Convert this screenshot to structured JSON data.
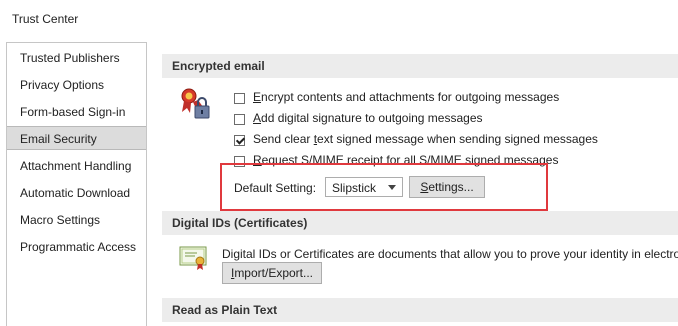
{
  "window": {
    "title": "Trust Center"
  },
  "sidebar": {
    "items": [
      {
        "label": "Trusted Publishers"
      },
      {
        "label": "Privacy Options"
      },
      {
        "label": "Form-based Sign-in"
      },
      {
        "label": "Email Security",
        "selected": true
      },
      {
        "label": "Attachment Handling"
      },
      {
        "label": "Automatic Download"
      },
      {
        "label": "Macro Settings"
      },
      {
        "label": "Programmatic Access"
      }
    ]
  },
  "encrypted": {
    "header": "Encrypted email",
    "icon": "security-certificate-lock-icon",
    "options": [
      {
        "pre": "",
        "u": "E",
        "post": "ncrypt contents and attachments for outgoing messages",
        "checked": false
      },
      {
        "pre": "",
        "u": "A",
        "post": "dd digital signature to outgoing messages",
        "checked": false
      },
      {
        "pre": "Send clear ",
        "u": "t",
        "post": "ext signed message when sending signed messages",
        "checked": true
      },
      {
        "pre": "",
        "u": "R",
        "post": "equest S/MIME receipt for all S/MIME signed messages",
        "checked": false
      }
    ],
    "default_setting_label": "Default Setting:",
    "default_setting_value": "Slipstick",
    "settings_button": {
      "u": "S",
      "post": "ettings..."
    }
  },
  "digital_ids": {
    "header": "Digital IDs (Certificates)",
    "icon": "certificate-icon",
    "description": "Digital IDs or Certificates are documents that allow you to prove your identity in electro",
    "import_export_button": {
      "u": "I",
      "post": "mport/Export..."
    }
  },
  "plain_text": {
    "header": "Read as Plain Text"
  },
  "colors": {
    "highlight": "#e0393e",
    "selected_nav": "#dcdcdc",
    "section_header": "#ececec"
  }
}
